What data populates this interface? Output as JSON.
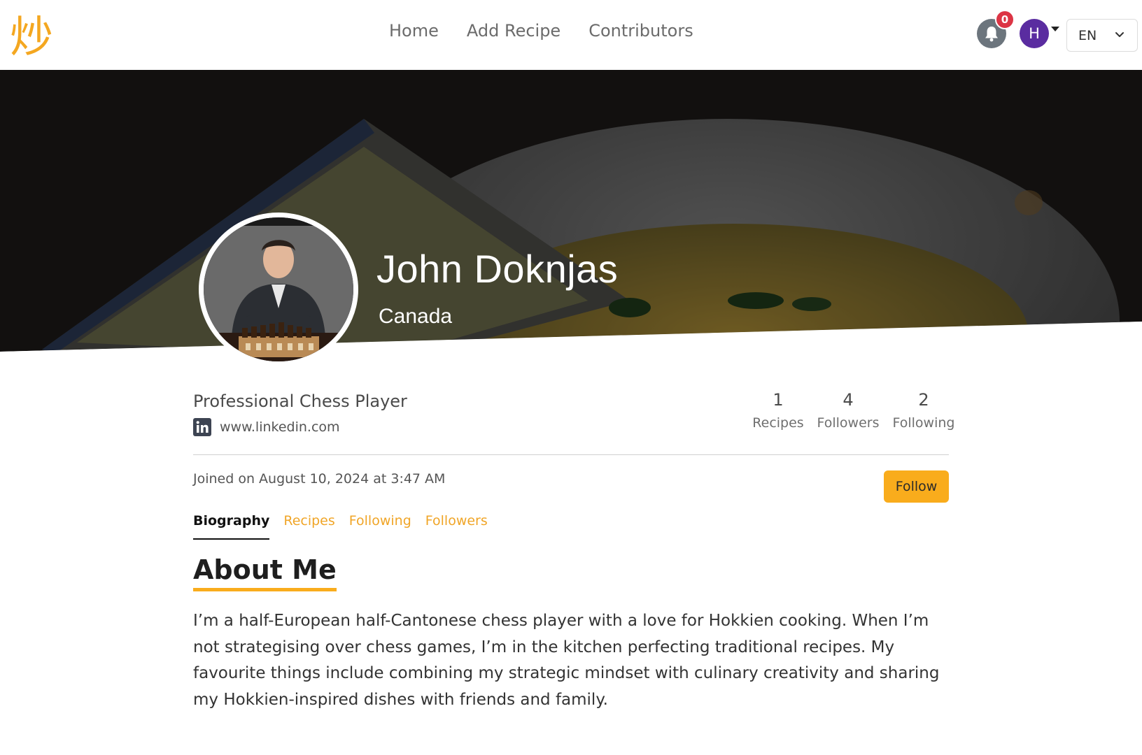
{
  "logo": {
    "glyph": "炒",
    "color": "#F4A720"
  },
  "nav": {
    "links": [
      "Home",
      "Add Recipe",
      "Contributors"
    ]
  },
  "notifications": {
    "count": "0"
  },
  "user_avatar": {
    "initial": "H",
    "color": "#5A2CA0"
  },
  "language": {
    "selected": "EN"
  },
  "profile": {
    "name": "John Doknjas",
    "country": "Canada",
    "occupation": "Professional Chess Player",
    "link": "www.linkedin.com",
    "joined": "Joined on August 10, 2024 at 3:47 AM",
    "follow_label": "Follow"
  },
  "stats": [
    {
      "value": "1",
      "label": "Recipes"
    },
    {
      "value": "4",
      "label": "Followers"
    },
    {
      "value": "2",
      "label": "Following"
    }
  ],
  "tabs": [
    {
      "label": "Biography",
      "active": true
    },
    {
      "label": "Recipes",
      "active": false
    },
    {
      "label": "Following",
      "active": false
    },
    {
      "label": "Followers",
      "active": false
    }
  ],
  "about": {
    "title": "About Me",
    "bio": "I’m a half-European half-Cantonese chess player with a love for Hokkien cooking. When I’m not strategising over chess games, I’m in the kitchen perfecting traditional recipes. My favourite things include combining my strategic mindset with culinary creativity and sharing my Hokkien-inspired dishes with friends and family."
  },
  "colors": {
    "accent": "#F9AC1C",
    "tab_link": "#F0A527",
    "badge": "#DC3545"
  }
}
